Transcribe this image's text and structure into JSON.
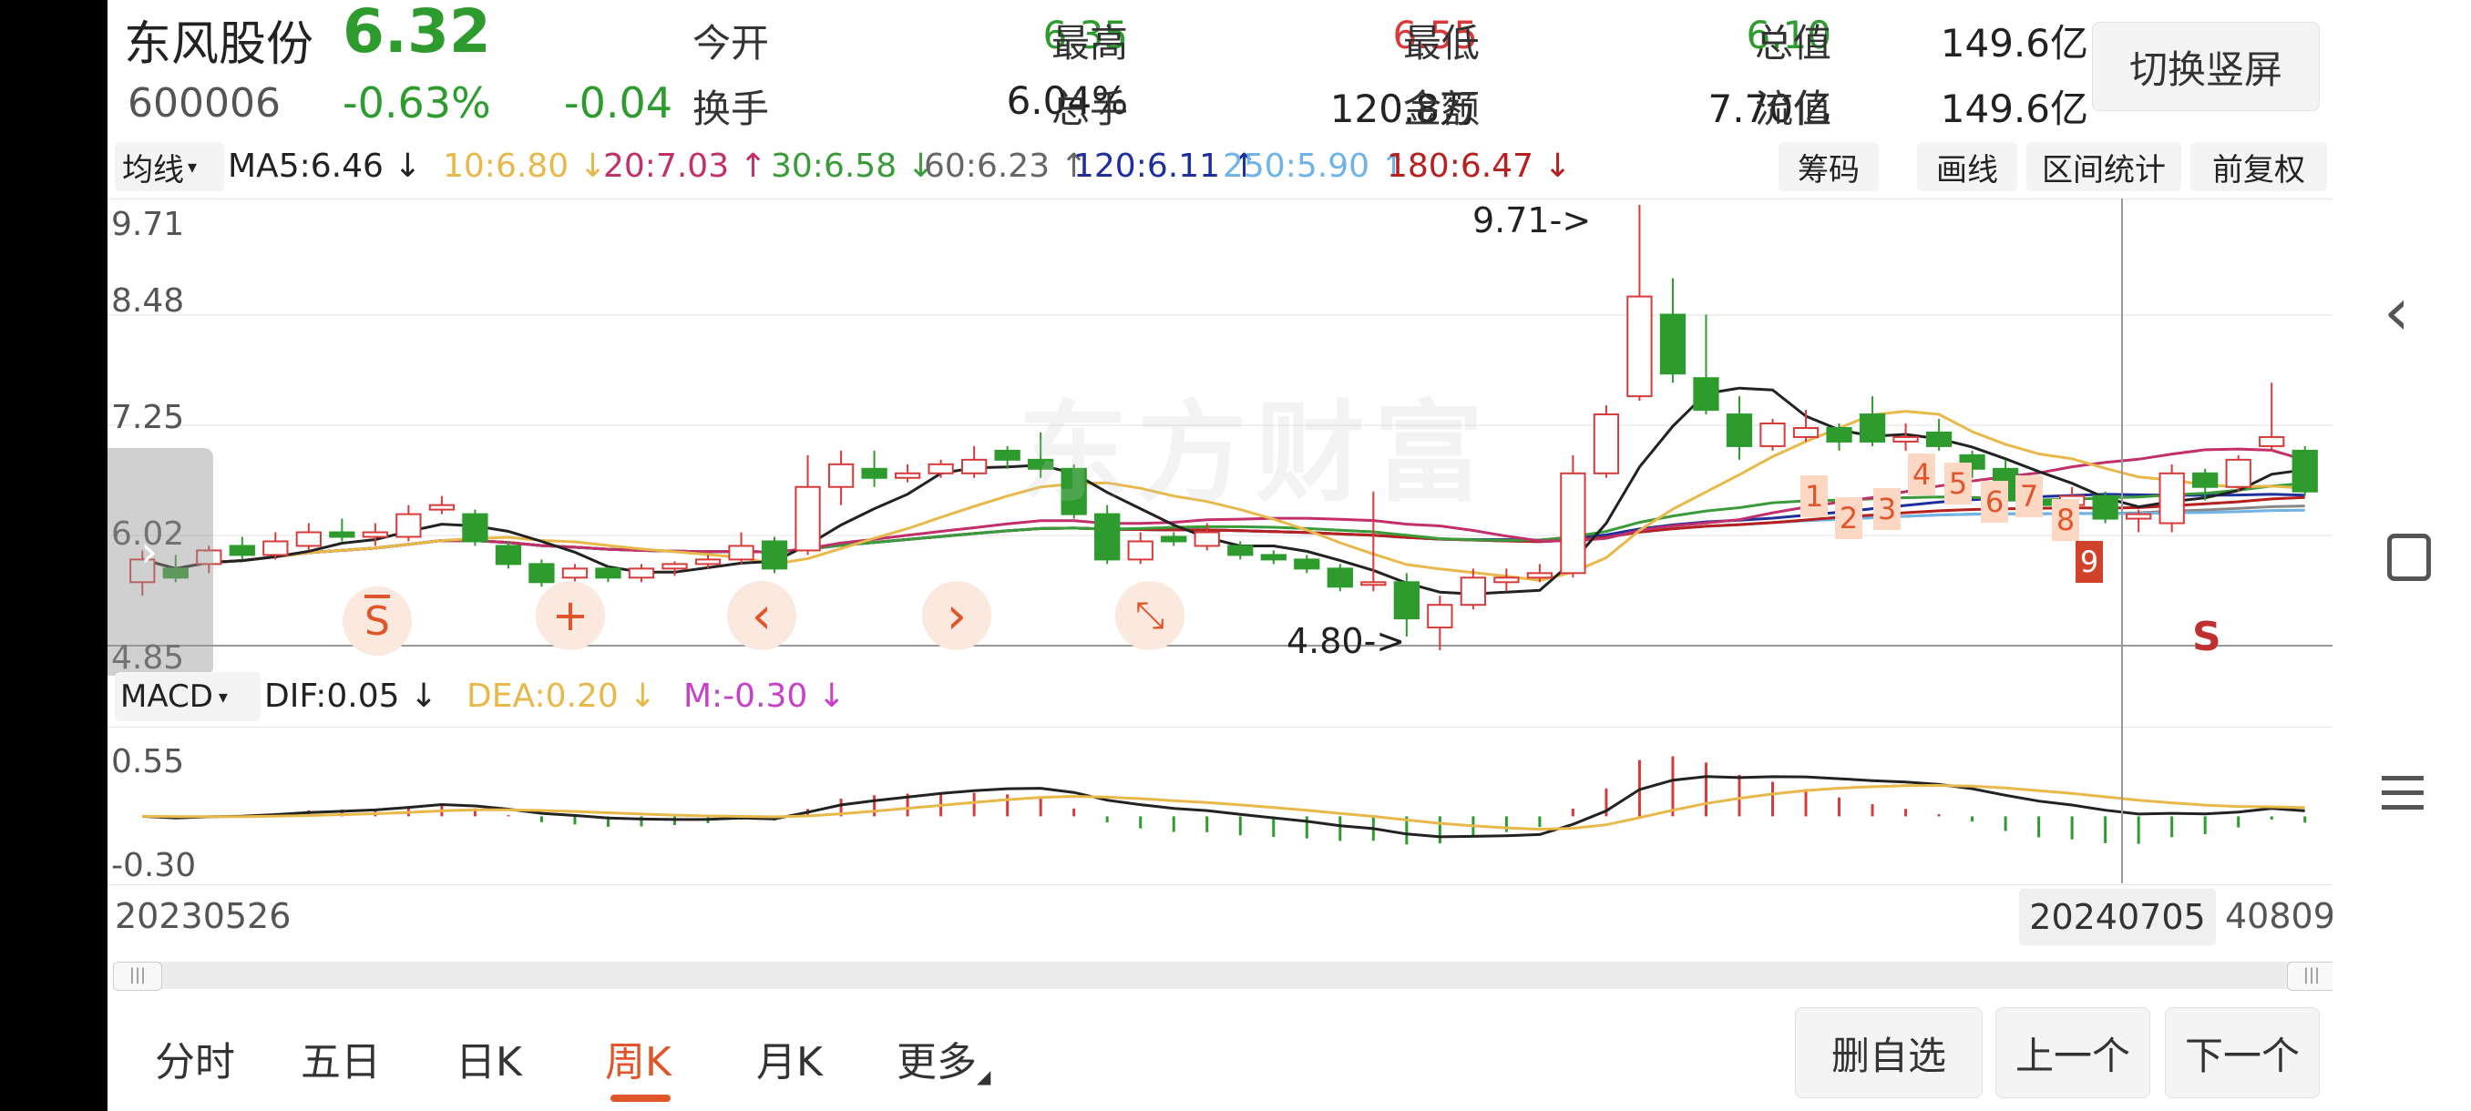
{
  "stock": {
    "name": "东风股份",
    "code": "600006",
    "price": "6.32",
    "change_pct": "-0.63%",
    "change": "-0.04"
  },
  "quote": {
    "open_label": "今开",
    "open": "6.35",
    "high_label": "最高",
    "high": "6.55",
    "low_label": "最低",
    "low": "6.10",
    "mktcap_label": "总值",
    "mktcap": "149.6亿",
    "turnover_label": "换手",
    "turnover": "6.04%",
    "volume_label": "总手",
    "volume": "120.8万",
    "amount_label": "金额",
    "amount": "7.70亿",
    "float_label": "流值",
    "float": "149.6亿"
  },
  "switch_button": "切换竖屏",
  "ma_bar": {
    "selector": "均线",
    "items": [
      {
        "text": "MA5:6.46",
        "arrow": "↓",
        "color": "#222222"
      },
      {
        "text": "10:6.80",
        "arrow": "↓",
        "color": "#e8b84a"
      },
      {
        "text": "20:7.03",
        "arrow": "↑",
        "color": "#c2306b"
      },
      {
        "text": "30:6.58",
        "arrow": "↓",
        "color": "#3a9b3a"
      },
      {
        "text": "60:6.23",
        "arrow": "↑",
        "color": "#666666"
      },
      {
        "text": "120:6.11",
        "arrow": "↑",
        "color": "#1f2f9e"
      },
      {
        "text": "250:5.90",
        "arrow": "↑",
        "color": "#6fb4e8"
      },
      {
        "text": "180:6.47",
        "arrow": "↓",
        "color": "#b81f1f"
      }
    ],
    "tools": [
      "筹码",
      "画线",
      "区间统计",
      "前复权"
    ]
  },
  "kline": {
    "y_ticks": [
      "9.71",
      "8.48",
      "7.25",
      "6.02",
      "4.85"
    ],
    "max_marker": "9.71->",
    "min_marker": "4.80->",
    "watermark": "东方财富",
    "signal_numbers": [
      "1",
      "2",
      "3",
      "4",
      "5",
      "6",
      "7",
      "8",
      "9"
    ],
    "sell_marker": "S",
    "ymin": 4.85,
    "ymax": 9.71
  },
  "overlay_icons": [
    {
      "name": "strategy-s-icon",
      "glyph": "S"
    },
    {
      "name": "add-icon",
      "glyph": "+"
    },
    {
      "name": "prev-icon",
      "glyph": "‹"
    },
    {
      "name": "next-icon",
      "glyph": "›"
    },
    {
      "name": "collapse-icon",
      "glyph": "⤡"
    }
  ],
  "macd": {
    "selector": "MACD",
    "dif": "DIF:0.05",
    "dif_arrow": "↓",
    "dea": "DEA:0.20",
    "dea_arrow": "↓",
    "m": "M:-0.30",
    "m_arrow": "↓",
    "y_ticks": [
      "0.55",
      "-0.30"
    ]
  },
  "dates": {
    "start": "20230526",
    "cursor": "20240705",
    "end": "40809"
  },
  "tabs": [
    "分时",
    "五日",
    "日K",
    "周K",
    "月K",
    "更多"
  ],
  "active_tab": "周K",
  "actions": {
    "remove": "删自选",
    "prev": "上一个",
    "next": "下一个"
  },
  "colors": {
    "up": "#d83a3a",
    "down": "#2e9b2e",
    "accent": "#e0552a"
  },
  "chart_data": {
    "type": "candlestick",
    "title": "",
    "ylim": [
      4.85,
      9.71
    ],
    "series": [
      {
        "o": 5.55,
        "c": 5.8,
        "h": 5.9,
        "l": 5.4
      },
      {
        "o": 5.7,
        "c": 5.6,
        "h": 5.85,
        "l": 5.55
      },
      {
        "o": 5.75,
        "c": 5.9,
        "h": 5.95,
        "l": 5.65
      },
      {
        "o": 5.95,
        "c": 5.85,
        "h": 6.05,
        "l": 5.8
      },
      {
        "o": 5.85,
        "c": 6.0,
        "h": 6.1,
        "l": 5.8
      },
      {
        "o": 5.95,
        "c": 6.1,
        "h": 6.2,
        "l": 5.9
      },
      {
        "o": 6.1,
        "c": 6.05,
        "h": 6.25,
        "l": 6.0
      },
      {
        "o": 6.05,
        "c": 6.1,
        "h": 6.2,
        "l": 5.95
      },
      {
        "o": 6.05,
        "c": 6.3,
        "h": 6.4,
        "l": 6.0
      },
      {
        "o": 6.35,
        "c": 6.4,
        "h": 6.5,
        "l": 6.3
      },
      {
        "o": 6.3,
        "c": 6.0,
        "h": 6.35,
        "l": 5.95
      },
      {
        "o": 5.95,
        "c": 5.75,
        "h": 6.0,
        "l": 5.7
      },
      {
        "o": 5.75,
        "c": 5.55,
        "h": 5.8,
        "l": 5.5
      },
      {
        "o": 5.6,
        "c": 5.7,
        "h": 5.75,
        "l": 5.55
      },
      {
        "o": 5.7,
        "c": 5.6,
        "h": 5.72,
        "l": 5.55
      },
      {
        "o": 5.6,
        "c": 5.7,
        "h": 5.75,
        "l": 5.55
      },
      {
        "o": 5.7,
        "c": 5.75,
        "h": 5.78,
        "l": 5.62
      },
      {
        "o": 5.75,
        "c": 5.8,
        "h": 5.85,
        "l": 5.7
      },
      {
        "o": 5.8,
        "c": 5.95,
        "h": 6.1,
        "l": 5.75
      },
      {
        "o": 6.0,
        "c": 5.7,
        "h": 6.05,
        "l": 5.65
      },
      {
        "o": 5.9,
        "c": 6.6,
        "h": 6.95,
        "l": 5.85
      },
      {
        "o": 6.6,
        "c": 6.85,
        "h": 7.0,
        "l": 6.4
      },
      {
        "o": 6.8,
        "c": 6.7,
        "h": 7.0,
        "l": 6.6
      },
      {
        "o": 6.7,
        "c": 6.75,
        "h": 6.85,
        "l": 6.65
      },
      {
        "o": 6.75,
        "c": 6.85,
        "h": 6.9,
        "l": 6.7
      },
      {
        "o": 6.75,
        "c": 6.9,
        "h": 7.05,
        "l": 6.7
      },
      {
        "o": 7.0,
        "c": 6.9,
        "h": 7.05,
        "l": 6.8
      },
      {
        "o": 6.9,
        "c": 6.8,
        "h": 7.2,
        "l": 6.7
      },
      {
        "o": 6.8,
        "c": 6.3,
        "h": 6.85,
        "l": 6.25
      },
      {
        "o": 6.3,
        "c": 5.8,
        "h": 6.4,
        "l": 5.75
      },
      {
        "o": 5.8,
        "c": 6.0,
        "h": 6.1,
        "l": 5.75
      },
      {
        "o": 6.05,
        "c": 6.0,
        "h": 6.1,
        "l": 5.95
      },
      {
        "o": 5.95,
        "c": 6.1,
        "h": 6.2,
        "l": 5.9
      },
      {
        "o": 5.95,
        "c": 5.85,
        "h": 6.0,
        "l": 5.8
      },
      {
        "o": 5.85,
        "c": 5.8,
        "h": 5.9,
        "l": 5.75
      },
      {
        "o": 5.8,
        "c": 5.7,
        "h": 5.85,
        "l": 5.65
      },
      {
        "o": 5.7,
        "c": 5.5,
        "h": 5.75,
        "l": 5.45
      },
      {
        "o": 5.55,
        "c": 5.55,
        "h": 6.55,
        "l": 5.45
      },
      {
        "o": 5.55,
        "c": 5.15,
        "h": 5.65,
        "l": 4.95
      },
      {
        "o": 5.05,
        "c": 5.3,
        "h": 5.4,
        "l": 4.8
      },
      {
        "o": 5.3,
        "c": 5.6,
        "h": 5.7,
        "l": 5.25
      },
      {
        "o": 5.55,
        "c": 5.6,
        "h": 5.7,
        "l": 5.45
      },
      {
        "o": 5.6,
        "c": 5.65,
        "h": 5.75,
        "l": 5.55
      },
      {
        "o": 5.65,
        "c": 6.75,
        "h": 6.95,
        "l": 5.6
      },
      {
        "o": 6.75,
        "c": 7.4,
        "h": 7.5,
        "l": 6.7
      },
      {
        "o": 7.6,
        "c": 8.7,
        "h": 9.71,
        "l": 7.55
      },
      {
        "o": 8.5,
        "c": 7.85,
        "h": 8.9,
        "l": 7.75
      },
      {
        "o": 7.8,
        "c": 7.45,
        "h": 8.5,
        "l": 7.4
      },
      {
        "o": 7.4,
        "c": 7.05,
        "h": 7.6,
        "l": 6.9
      },
      {
        "o": 7.05,
        "c": 7.3,
        "h": 7.35,
        "l": 7.0
      },
      {
        "o": 7.15,
        "c": 7.25,
        "h": 7.45,
        "l": 7.1
      },
      {
        "o": 7.25,
        "c": 7.1,
        "h": 7.3,
        "l": 7.0
      },
      {
        "o": 7.4,
        "c": 7.1,
        "h": 7.6,
        "l": 7.05
      },
      {
        "o": 7.1,
        "c": 7.15,
        "h": 7.3,
        "l": 7.0
      },
      {
        "o": 7.2,
        "c": 7.05,
        "h": 7.35,
        "l": 7.0
      },
      {
        "o": 6.95,
        "c": 6.8,
        "h": 7.0,
        "l": 6.7
      },
      {
        "o": 6.8,
        "c": 6.45,
        "h": 6.9,
        "l": 6.4
      },
      {
        "o": 6.45,
        "c": 6.4,
        "h": 6.5,
        "l": 6.35
      },
      {
        "o": 6.4,
        "c": 6.5,
        "h": 6.6,
        "l": 6.35
      },
      {
        "o": 6.5,
        "c": 6.25,
        "h": 6.55,
        "l": 6.2
      },
      {
        "o": 6.25,
        "c": 6.3,
        "h": 6.35,
        "l": 6.1
      },
      {
        "o": 6.2,
        "c": 6.75,
        "h": 6.85,
        "l": 6.1
      },
      {
        "o": 6.75,
        "c": 6.6,
        "h": 6.8,
        "l": 6.45
      },
      {
        "o": 6.6,
        "c": 6.9,
        "h": 6.95,
        "l": 6.55
      },
      {
        "o": 7.05,
        "c": 7.15,
        "h": 7.75,
        "l": 7.0
      },
      {
        "o": 7.0,
        "c": 6.55,
        "h": 7.05,
        "l": 6.5
      }
    ]
  }
}
